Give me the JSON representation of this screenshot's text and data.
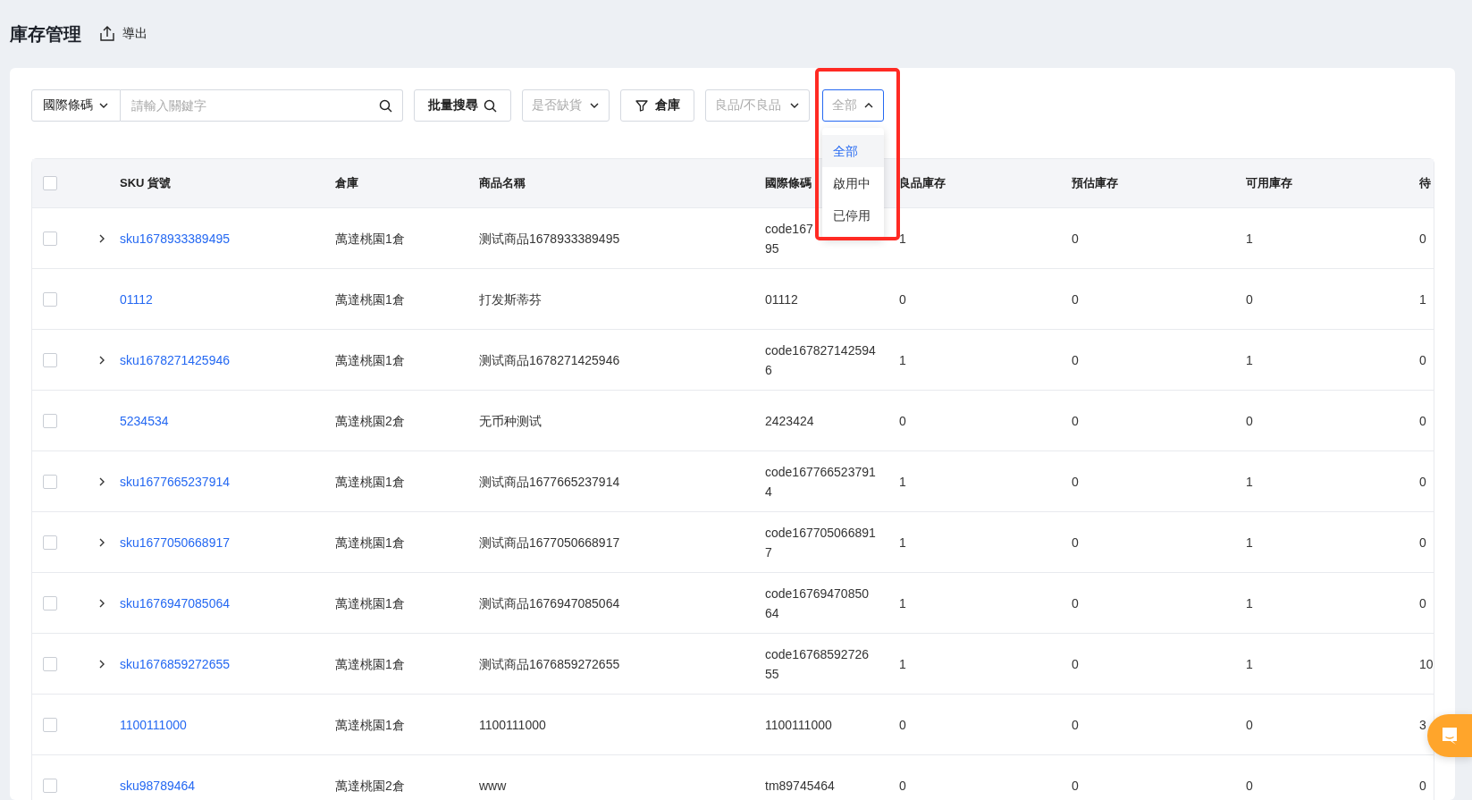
{
  "page": {
    "title": "庫存管理",
    "export_label": "導出"
  },
  "toolbar": {
    "field_select": "國際條碼",
    "search": {
      "placeholder": "請輸入關鍵字"
    },
    "batch_search": "批量搜尋",
    "stock_filter": {
      "placeholder": "是否缺貨"
    },
    "warehouse_filter": "倉庫",
    "quality_filter": {
      "placeholder": "良品/不良品"
    },
    "status_filter": {
      "placeholder": "全部",
      "expanded": true,
      "options": [
        {
          "label": "全部",
          "selected": true
        },
        {
          "label": "啟用中",
          "selected": false
        },
        {
          "label": "已停用",
          "selected": false
        }
      ]
    }
  },
  "table": {
    "select_all": {
      "checked": false
    },
    "columns": [
      "SKU 貨號",
      "倉庫",
      "商品名稱",
      "國際條碼",
      "良品庫存",
      "預估庫存",
      "可用庫存",
      "待"
    ],
    "rows": [
      {
        "checked": false,
        "expandable": true,
        "cells": [
          "sku1678933389495",
          "萬達桃園1倉",
          "测试商品1678933389495",
          "code167\n95",
          "1",
          "0",
          "1",
          "0"
        ]
      },
      {
        "checked": false,
        "expandable": false,
        "cells": [
          "01112",
          "萬達桃園1倉",
          "打发斯蒂芬",
          "01112",
          "0",
          "0",
          "0",
          "1"
        ]
      },
      {
        "checked": false,
        "expandable": true,
        "cells": [
          "sku1678271425946",
          "萬達桃園1倉",
          "测试商品1678271425946",
          "code167827142594\n6",
          "1",
          "0",
          "1",
          "0"
        ]
      },
      {
        "checked": false,
        "expandable": false,
        "cells": [
          "5234534",
          "萬達桃園2倉",
          "无币种测试",
          "2423424",
          "0",
          "0",
          "0",
          "0"
        ]
      },
      {
        "checked": false,
        "expandable": true,
        "cells": [
          "sku1677665237914",
          "萬達桃園1倉",
          "测试商品1677665237914",
          "code167766523791\n4",
          "1",
          "0",
          "1",
          "0"
        ]
      },
      {
        "checked": false,
        "expandable": true,
        "cells": [
          "sku1677050668917",
          "萬達桃園1倉",
          "测试商品1677050668917",
          "code167705066891\n7",
          "1",
          "0",
          "1",
          "0"
        ]
      },
      {
        "checked": false,
        "expandable": true,
        "cells": [
          "sku1676947085064",
          "萬達桃園1倉",
          "测试商品1676947085064",
          "code16769470850\n64",
          "1",
          "0",
          "1",
          "0"
        ]
      },
      {
        "checked": false,
        "expandable": true,
        "cells": [
          "sku1676859272655",
          "萬達桃園1倉",
          "测试商品1676859272655",
          "code16768592726\n55",
          "1",
          "0",
          "1",
          "10"
        ]
      },
      {
        "checked": false,
        "expandable": false,
        "cells": [
          "1100111000",
          "萬達桃園1倉",
          "1100111000",
          "1100111000",
          "0",
          "0",
          "0",
          "3"
        ]
      },
      {
        "checked": false,
        "expandable": false,
        "cells": [
          "sku98789464",
          "萬達桃園2倉",
          "www",
          "tm89745464",
          "0",
          "0",
          "0",
          "0"
        ]
      }
    ]
  }
}
